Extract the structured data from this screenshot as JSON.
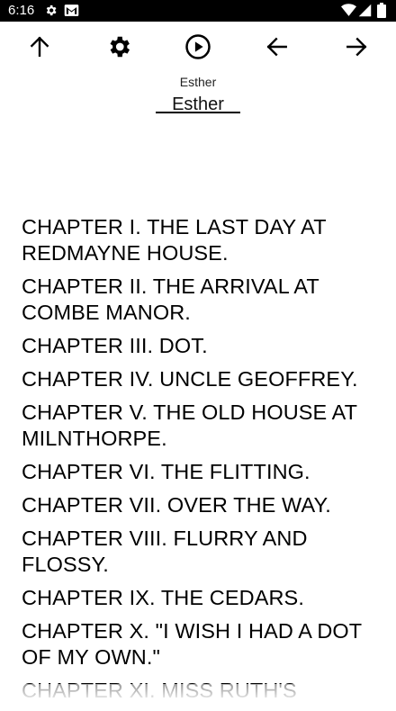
{
  "status_bar": {
    "time": "6:16",
    "icons": [
      "gear-icon",
      "gmail-icon",
      "wifi-icon",
      "signal-icon",
      "battery-icon"
    ],
    "background": "#000000"
  },
  "toolbar": {
    "buttons": [
      {
        "name": "up-button",
        "icon": "arrow-up-icon"
      },
      {
        "name": "settings-button",
        "icon": "gear-icon"
      },
      {
        "name": "play-button",
        "icon": "play-circle-icon"
      },
      {
        "name": "back-button",
        "icon": "arrow-left-icon"
      },
      {
        "name": "forward-button",
        "icon": "arrow-right-icon"
      }
    ]
  },
  "book": {
    "title": "Esther",
    "selected_chapter": "Esther"
  },
  "chapters": [
    "CHAPTER I. THE LAST DAY AT REDMAYNE HOUSE.",
    "CHAPTER II. THE ARRIVAL AT COMBE MANOR.",
    "CHAPTER III. DOT.",
    "CHAPTER IV. UNCLE GEOFFREY.",
    "CHAPTER V. THE OLD HOUSE AT MILNTHORPE.",
    "CHAPTER VI. THE FLITTING.",
    "CHAPTER VII. OVER THE WAY.",
    "CHAPTER VIII. FLURRY AND FLOSSY.",
    "CHAPTER IX. THE CEDARS.",
    "CHAPTER X. \"I WISH I HAD A DOT OF MY OWN.\"",
    "CHAPTER XI. MISS RUTH'S"
  ]
}
